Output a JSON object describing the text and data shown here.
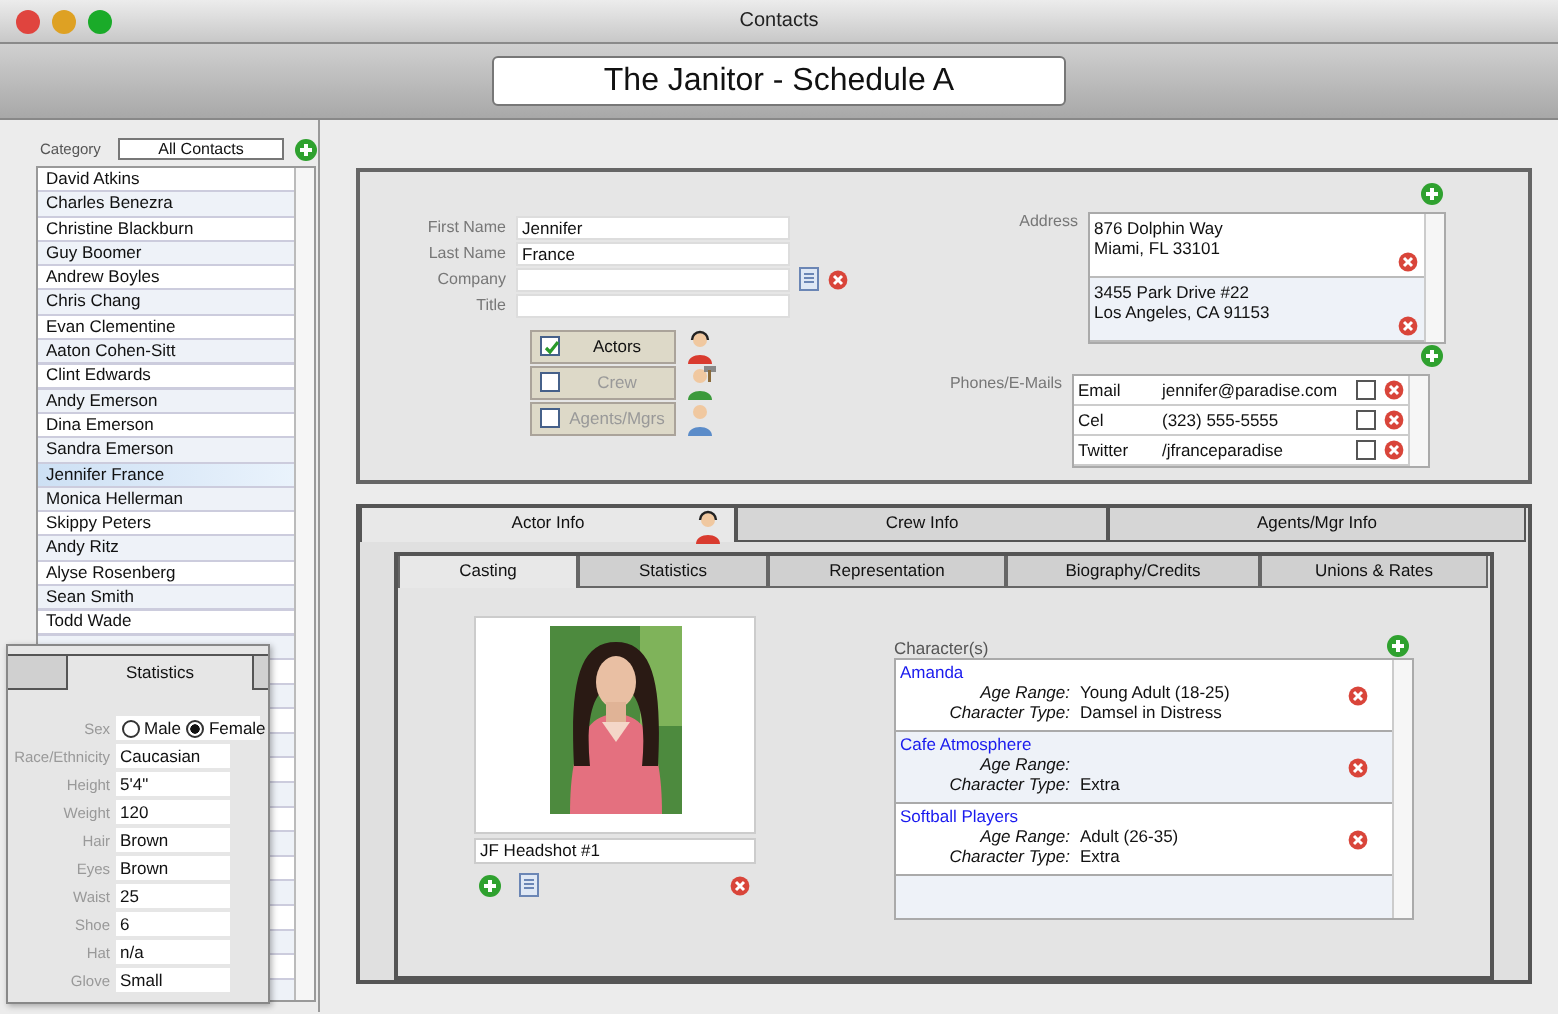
{
  "window": {
    "title": "Contacts"
  },
  "header": {
    "title": "The Janitor - Schedule A"
  },
  "sidebar": {
    "category_label": "Category",
    "category": "All Contacts",
    "contacts": [
      {
        "name": "David Atkins",
        "selected": false
      },
      {
        "name": "Charles Benezra",
        "selected": false
      },
      {
        "name": "Christine Blackburn",
        "selected": false
      },
      {
        "name": "Guy Boomer",
        "selected": false
      },
      {
        "name": "Andrew Boyles",
        "selected": false
      },
      {
        "name": "Chris Chang",
        "selected": false
      },
      {
        "name": "Evan Clementine",
        "selected": false
      },
      {
        "name": "Aaton Cohen-Sitt",
        "selected": false
      },
      {
        "name": "Clint Edwards",
        "selected": false
      },
      {
        "name": "Andy Emerson",
        "selected": false
      },
      {
        "name": "Dina Emerson",
        "selected": false
      },
      {
        "name": "Sandra Emerson",
        "selected": false
      },
      {
        "name": "Jennifer France",
        "selected": true
      },
      {
        "name": "Monica Hellerman",
        "selected": false
      },
      {
        "name": "Skippy Peters",
        "selected": false
      },
      {
        "name": "Andy Ritz",
        "selected": false
      },
      {
        "name": "Alyse Rosenberg",
        "selected": false
      },
      {
        "name": "Sean Smith",
        "selected": false
      },
      {
        "name": "Todd Wade",
        "selected": false
      }
    ]
  },
  "contact": {
    "fields": [
      {
        "label": "First Name",
        "value": "Jennifer"
      },
      {
        "label": "Last Name",
        "value": "France"
      },
      {
        "label": "Company"
      },
      {
        "label": "Title"
      }
    ],
    "roles": [
      {
        "label": "Actors",
        "kind": "actor",
        "checked": true
      },
      {
        "label": "Crew",
        "kind": "crew",
        "checked": false
      },
      {
        "label": "Agents/Mgrs",
        "kind": "agent",
        "checked": false
      }
    ],
    "address_label": "Address",
    "addresses": [
      {
        "lines": [
          "876 Dolphin Way",
          "Miami, FL 33101"
        ]
      },
      {
        "lines": [
          "3455 Park Drive #22",
          "Los Angeles, CA 91153"
        ]
      }
    ],
    "phones_label": "Phones/E-Mails",
    "phones": [
      {
        "type": "Email",
        "value": "jennifer@paradise.com",
        "checked": false
      },
      {
        "type": "Cel",
        "value": "(323) 555-5555",
        "checked": false
      },
      {
        "type": "Twitter",
        "value": "/jfranceparadise",
        "checked": false
      }
    ]
  },
  "info_tabs": [
    {
      "label": "Actor Info",
      "selected": true,
      "kind": "actor"
    },
    {
      "label": "Crew Info",
      "selected": false
    },
    {
      "label": "Agents/Mgr Info",
      "selected": false
    }
  ],
  "sub_tabs": [
    {
      "label": "Casting",
      "selected": true
    },
    {
      "label": "Statistics",
      "selected": false
    },
    {
      "label": "Representation",
      "selected": false
    },
    {
      "label": "Biography/Credits",
      "selected": false
    },
    {
      "label": "Unions & Rates",
      "selected": false
    }
  ],
  "casting": {
    "photo_caption": "JF Headshot #1",
    "characters_label": "Character(s)",
    "characters": [
      {
        "name": "Amanda",
        "age_label": "Age Range:",
        "age_range": "Young Adult (18-25)",
        "type_label": "Character Type:",
        "type": "Damsel in Distress"
      },
      {
        "name": "Cafe Atmosphere",
        "age_label": "Age Range:",
        "type_label": "Character Type:",
        "type": "Extra"
      },
      {
        "name": "Softball Players",
        "age_label": "Age Range:",
        "age_range": "Adult (26-35)",
        "type_label": "Character Type:",
        "type": "Extra"
      }
    ]
  },
  "statistics_panel": {
    "tab": "Statistics",
    "sex_label": "Sex",
    "sex_options": [
      {
        "label": "Male",
        "selected": false
      },
      {
        "label": "Female",
        "selected": true
      }
    ],
    "fields": [
      {
        "label": "Race/Ethnicity",
        "value": "Caucasian"
      },
      {
        "label": "Height",
        "value": "5'4\""
      },
      {
        "label": "Weight",
        "value": "120"
      },
      {
        "label": "Hair",
        "value": "Brown"
      },
      {
        "label": "Eyes",
        "value": "Brown"
      },
      {
        "label": "Waist",
        "value": "25"
      },
      {
        "label": "Shoe",
        "value": "6"
      },
      {
        "label": "Hat",
        "value": "n/a"
      },
      {
        "label": "Glove",
        "value": "Small"
      }
    ]
  }
}
